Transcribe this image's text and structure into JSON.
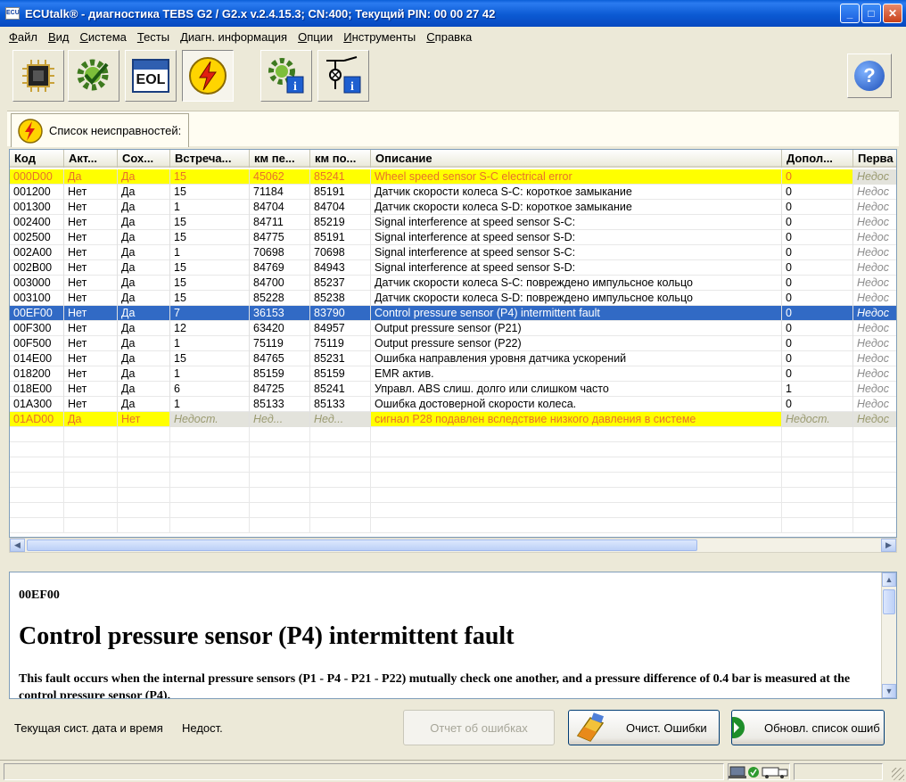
{
  "window": {
    "title": "ECUtalk® - диагностика TEBS G2 / G2.x v.2.4.15.3; CN:400; Текущий PIN: 00 00 27 42",
    "icon_text": "ECU",
    "minimize": "_",
    "maximize": "□",
    "close": "✕"
  },
  "menu": [
    "Файл",
    "Вид",
    "Система",
    "Тесты",
    "Диагн. информация",
    "Опции",
    "Инструменты",
    "Справка"
  ],
  "toolbar": {
    "eol_label": "EOL",
    "help_label": "?"
  },
  "panel": {
    "tab_label": "Список неисправностей:"
  },
  "table": {
    "columns": [
      "Код",
      "Акт...",
      "Сох...",
      "Встреча...",
      "км пе...",
      "км по...",
      "Описание",
      "Допол...",
      "Перва"
    ],
    "rows": [
      {
        "code": "000D00",
        "active": "Да",
        "stored": "Да",
        "count": "15",
        "km_first": "45062",
        "km_last": "85241",
        "desc": "Wheel speed sensor S-C electrical error",
        "extra": "0",
        "first": "Недос",
        "style": "yellow"
      },
      {
        "code": "001200",
        "active": "Нет",
        "stored": "Да",
        "count": "15",
        "km_first": "71184",
        "km_last": "85191",
        "desc": "Датчик скорости колеса S-C: короткое замыкание",
        "extra": "0",
        "first": "Недос",
        "style": ""
      },
      {
        "code": "001300",
        "active": "Нет",
        "stored": "Да",
        "count": "1",
        "km_first": "84704",
        "km_last": "84704",
        "desc": "Датчик скорости колеса S-D: короткое замыкание",
        "extra": "0",
        "first": "Недос",
        "style": ""
      },
      {
        "code": "002400",
        "active": "Нет",
        "stored": "Да",
        "count": "15",
        "km_first": "84711",
        "km_last": "85219",
        "desc": "Signal interference at speed sensor S-C:",
        "extra": "0",
        "first": "Недос",
        "style": ""
      },
      {
        "code": "002500",
        "active": "Нет",
        "stored": "Да",
        "count": "15",
        "km_first": "84775",
        "km_last": "85191",
        "desc": "Signal interference at speed sensor S-D:",
        "extra": "0",
        "first": "Недос",
        "style": ""
      },
      {
        "code": "002A00",
        "active": "Нет",
        "stored": "Да",
        "count": "1",
        "km_first": "70698",
        "km_last": "70698",
        "desc": "Signal interference at speed sensor S-C:",
        "extra": "0",
        "first": "Недос",
        "style": ""
      },
      {
        "code": "002B00",
        "active": "Нет",
        "stored": "Да",
        "count": "15",
        "km_first": "84769",
        "km_last": "84943",
        "desc": "Signal interference at speed sensor S-D:",
        "extra": "0",
        "first": "Недос",
        "style": ""
      },
      {
        "code": "003000",
        "active": "Нет",
        "stored": "Да",
        "count": "15",
        "km_first": "84700",
        "km_last": "85237",
        "desc": "Датчик скорости колеса S-C: повреждено импульсное кольцо",
        "extra": "0",
        "first": "Недос",
        "style": ""
      },
      {
        "code": "003100",
        "active": "Нет",
        "stored": "Да",
        "count": "15",
        "km_first": "85228",
        "km_last": "85238",
        "desc": "Датчик скорости колеса S-D: повреждено импульсное кольцо",
        "extra": "0",
        "first": "Недос",
        "style": ""
      },
      {
        "code": "00EF00",
        "active": "Нет",
        "stored": "Да",
        "count": "7",
        "km_first": "36153",
        "km_last": "83790",
        "desc": "Control pressure sensor (P4) intermittent fault",
        "extra": "0",
        "first": "Недос",
        "style": "sel"
      },
      {
        "code": "00F300",
        "active": "Нет",
        "stored": "Да",
        "count": "12",
        "km_first": "63420",
        "km_last": "84957",
        "desc": "Output pressure sensor (P21)",
        "extra": "0",
        "first": "Недос",
        "style": ""
      },
      {
        "code": "00F500",
        "active": "Нет",
        "stored": "Да",
        "count": "1",
        "km_first": "75119",
        "km_last": "75119",
        "desc": "Output pressure sensor (P22)",
        "extra": "0",
        "first": "Недос",
        "style": ""
      },
      {
        "code": "014E00",
        "active": "Нет",
        "stored": "Да",
        "count": "15",
        "km_first": "84765",
        "km_last": "85231",
        "desc": "Ошибка направления уровня датчика ускорений",
        "extra": "0",
        "first": "Недос",
        "style": ""
      },
      {
        "code": "018200",
        "active": "Нет",
        "stored": "Да",
        "count": "1",
        "km_first": "85159",
        "km_last": "85159",
        "desc": "EMR актив.",
        "extra": "0",
        "first": "Недос",
        "style": ""
      },
      {
        "code": "018E00",
        "active": "Нет",
        "stored": "Да",
        "count": "6",
        "km_first": "84725",
        "km_last": "85241",
        "desc": "Управл. ABS слиш. долго или слишком часто",
        "extra": "1",
        "first": "Недос",
        "style": ""
      },
      {
        "code": "01A300",
        "active": "Нет",
        "stored": "Да",
        "count": "1",
        "km_first": "85133",
        "km_last": "85133",
        "desc": "Ошибка достоверной скорости колеса.",
        "extra": "0",
        "first": "Недос",
        "style": ""
      },
      {
        "code": "01AD00",
        "active": "Да",
        "stored": "Нет",
        "count": "Недост.",
        "km_first": "Нед...",
        "km_last": "Нед...",
        "desc": "сигнал P28 подавлен вследствие низкого давления в системе",
        "extra": "Недост.",
        "first": "Недос",
        "style": "yellow"
      }
    ],
    "na_values": [
      "Недост.",
      "Нед...",
      "Недос"
    ],
    "empty_rows": 7
  },
  "details": {
    "code": "00EF00",
    "title": "Control pressure sensor (P4) intermittent fault",
    "text": "This fault occurs when the internal pressure sensors (P1 - P4 - P21 - P22) mutually check one another, and a pressure difference of 0.4 bar is measured at the control pressure sensor (P4)."
  },
  "bottom": {
    "datetime_label": "Текущая сист. дата и время",
    "datetime_value": "Недост.",
    "report_button": "Отчет об ошибках",
    "clear_button": "Очист. Ошибки",
    "refresh_button": "Обновл. список ошиб"
  },
  "colors": {
    "selected_row": "#316AC5",
    "highlight_row": "#FFFF00",
    "highlight_text": "#E8702A",
    "titlebar": "#0A5FD8"
  }
}
